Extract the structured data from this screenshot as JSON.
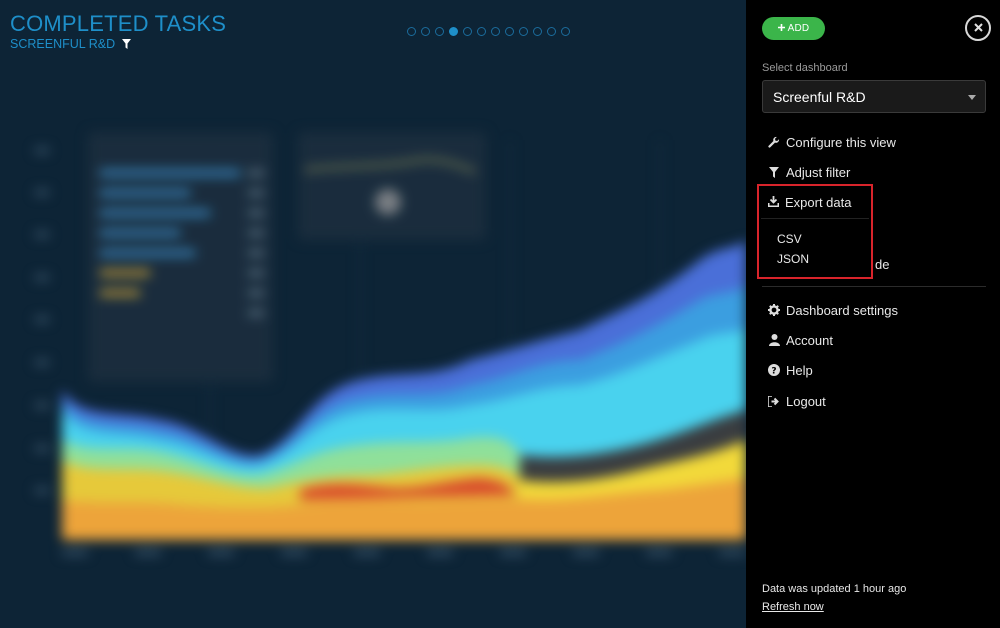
{
  "dashboard": {
    "title": "COMPLETED TASKS",
    "subtitle": "SCREENFUL R&D",
    "pager": {
      "count": 12,
      "active_index": 3
    },
    "colors": {
      "accent": "#1e8fc9",
      "background": "#0d2436"
    }
  },
  "panel": {
    "add_label": "ADD",
    "select_label": "Select dashboard",
    "select_value": "Screenful R&D",
    "menu": {
      "configure": "Configure this view",
      "adjust_filter": "Adjust filter",
      "export": "Export data",
      "export_options": [
        "CSV",
        "JSON"
      ],
      "partially_hidden_item_tail": "de",
      "dashboard_settings": "Dashboard settings",
      "account": "Account",
      "help": "Help",
      "logout": "Logout"
    },
    "updated_text": "Data was updated 1 hour ago",
    "refresh_label": "Refresh now",
    "icons": {
      "add": "plus-icon",
      "close": "close-icon",
      "configure": "wrench-icon",
      "filter": "filter-icon",
      "export": "download-icon",
      "settings": "gear-icon",
      "account": "user-icon",
      "help": "question-icon",
      "logout": "sign-out-icon"
    },
    "colors": {
      "add_button": "#3bb54a",
      "highlight_border": "#d9242b",
      "panel_bg": "#000000"
    }
  }
}
